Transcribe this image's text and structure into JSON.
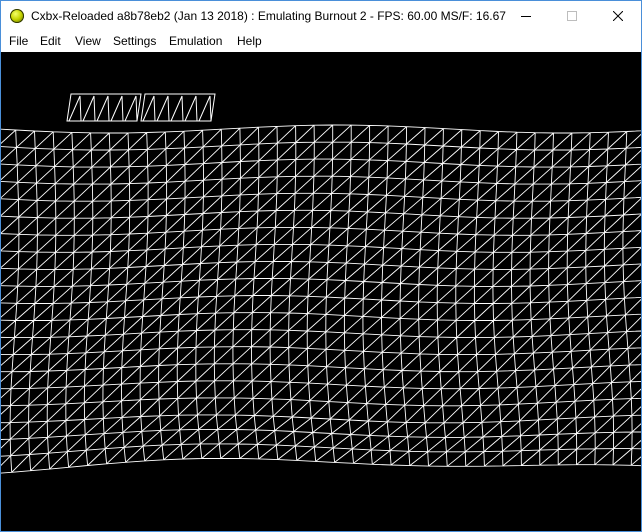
{
  "window": {
    "title": "Cxbx-Reloaded a8b78eb2 (Jan 13 2018) : Emulating Burnout 2 - FPS: 60.00  MS/F: 16.67",
    "controls": {
      "minimize": "minimize-icon",
      "maximize": "maximize-icon",
      "close": "close-icon"
    }
  },
  "menu": {
    "file": "File",
    "edit": "Edit",
    "view": "View",
    "settings": "Settings",
    "emulation": "Emulation",
    "help": "Help"
  },
  "viewport": {
    "background": "#000000",
    "wireframe_color": "#ffffff",
    "render_mode": "wireframe"
  }
}
